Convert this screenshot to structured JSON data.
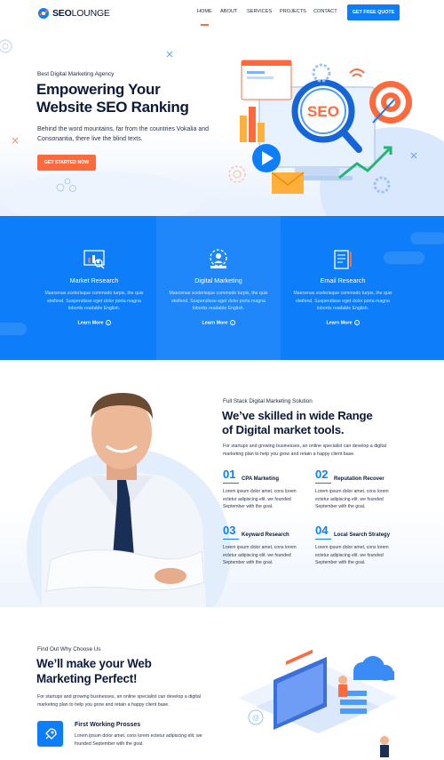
{
  "nav": {
    "brand_seo": "SEO",
    "brand_rest": "LOUNGE",
    "items": [
      {
        "label": "HOME",
        "active": true
      },
      {
        "label": "ABOUT",
        "active": false
      },
      {
        "label": "SERVICES",
        "active": false
      },
      {
        "label": "PROJECTS",
        "active": false
      },
      {
        "label": "CONTACT",
        "active": false
      }
    ],
    "quote_button": "GET FREE QUOTE"
  },
  "hero": {
    "kicker": "Best Digital Marketing Agency",
    "title_line1": "Empowering Your",
    "title_line2": "Website SEO Ranking",
    "description": "Behind the word mountains, far from the countries Vokalia and Consonantia, there live the blind texts.",
    "cta": "GET STARTED NOW",
    "illustration_label": "SEO"
  },
  "services": [
    {
      "icon": "market-research-icon",
      "title": "Market Research",
      "text": "Maecenas scelerisque commodo turpis, the quis eleifend. Suspendisse eget dolor porta magna lobortis readable English.",
      "link": "Learn More"
    },
    {
      "icon": "digital-marketing-icon",
      "title": "Digital Marketing",
      "text": "Maecenas scelerisque commodo turpis, the quis eleifend. Suspendisse eget dolor porta magna lobortis readable English.",
      "link": "Learn More"
    },
    {
      "icon": "email-research-icon",
      "title": "Email Research",
      "text": "Maecenas scelerisque commodo turpis, the quis eleifend. Suspendisse eget dolor porta magna lobortis readable English.",
      "link": "Learn More"
    }
  ],
  "skills": {
    "kicker": "Full Stack Digital Marketing Solution",
    "title_line1": "We’ve skilled in wide Range",
    "title_line2": "of Digital market tools.",
    "description": "For startups and growing businesses, an online specialist can develop a digital marketing plan to help you grow and retain a happy client base.",
    "features": [
      {
        "num": "01",
        "title": "CPA Marketing",
        "text": "Lorem ipsum dolor amet, cons lorem ectetur adipiscing elit. we founded September with the goal."
      },
      {
        "num": "02",
        "title": "Reputation Recover",
        "text": "Lorem ipsum dolor amet, cons lorem ectetur adipiscing elit. we founded September with the goal."
      },
      {
        "num": "03",
        "title": "Keyward Research",
        "text": "Lorem ipsum dolor amet, cons lorem ectetur adipiscing elit. we founded September with the goal."
      },
      {
        "num": "04",
        "title": "Local Search Strategy",
        "text": "Lorem ipsum dolor amet, cons lorem ectetur adipiscing elit. we founded September with the goal."
      }
    ]
  },
  "why": {
    "kicker": "Find Out Why Choose Us",
    "title_line1": "We’ll make your Web",
    "title_line2": "Marketing Perfect!",
    "description": "For startups and growing businesses, an online specialist can develop a digital marketing plan to help you grow and retain a happy client base.",
    "feature_title": "First Working Prosses",
    "feature_text": "Lorem ipsum dolor amet, cons lorem ectetur adipiscing elit. we founded September with the goal."
  },
  "colors": {
    "primary": "#0d7df9",
    "accent": "#ff6a3d",
    "heading": "#0c1a3a"
  }
}
